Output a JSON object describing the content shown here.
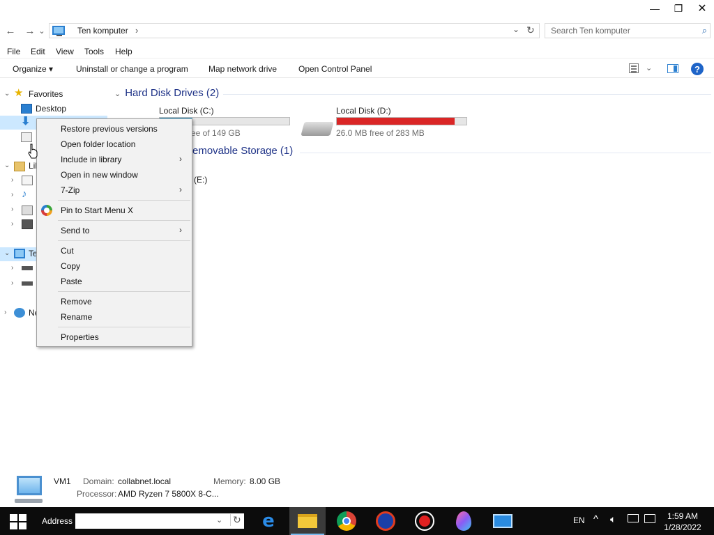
{
  "window": {
    "minimize": "—",
    "maximize": "❐",
    "close": "✕"
  },
  "address": {
    "back": "←",
    "forward": "→",
    "recent": "⌄",
    "crumb": "Ten komputer",
    "crumb_sep": "›",
    "dropdown": "⌄",
    "refresh": "↻",
    "search_placeholder": "Search Ten komputer"
  },
  "menubar": [
    "File",
    "Edit",
    "View",
    "Tools",
    "Help"
  ],
  "commandbar": {
    "organize": "Organize",
    "organize_arrow": "▾",
    "uninstall": "Uninstall or change a program",
    "map_drive": "Map network drive",
    "control_panel": "Open Control Panel",
    "view_dropdown": "⌄",
    "help": "?"
  },
  "navpane": {
    "favorites": "Favorites",
    "desktop": "Desktop",
    "libraries_partial": "Lil",
    "computer_partial": "Te",
    "network_partial": "Ne"
  },
  "content": {
    "hdd_group": "Hard Disk Drives (2)",
    "removable_group": "emovable Storage (1)",
    "group_chevron": "⌄",
    "drives": [
      {
        "name": "Local Disk (C:)",
        "free_text": "ee of 149 GB",
        "used_fraction": 0.25,
        "fill_color": "#26a0da"
      },
      {
        "name": "Local Disk (D:)",
        "free_text": "26.0 MB free of 283 MB",
        "used_fraction": 0.91,
        "fill_color": "#da2626"
      }
    ],
    "removable_partial": "(E:)"
  },
  "details": {
    "name": "VM1",
    "domain_label": "Domain:",
    "domain_value": "collabnet.local",
    "memory_label": "Memory:",
    "memory_value": "8.00 GB",
    "processor_label": "Processor:",
    "processor_value": "AMD Ryzen 7 5800X 8-C..."
  },
  "context_menu": {
    "restore": "Restore previous versions",
    "open_location": "Open folder location",
    "include_library": "Include in library",
    "new_window": "Open in new window",
    "seven_zip": "7-Zip",
    "pin_start": "Pin to Start Menu X",
    "send_to": "Send to",
    "cut": "Cut",
    "copy": "Copy",
    "paste": "Paste",
    "remove": "Remove",
    "rename": "Rename",
    "properties": "Properties",
    "submenu_arrow": "›"
  },
  "taskbar": {
    "address_label": "Address",
    "address_dropdown": "⌄",
    "address_refresh": "↻",
    "language": "EN",
    "tray_up": "^",
    "time": "1:59 AM",
    "date": "1/28/2022"
  }
}
